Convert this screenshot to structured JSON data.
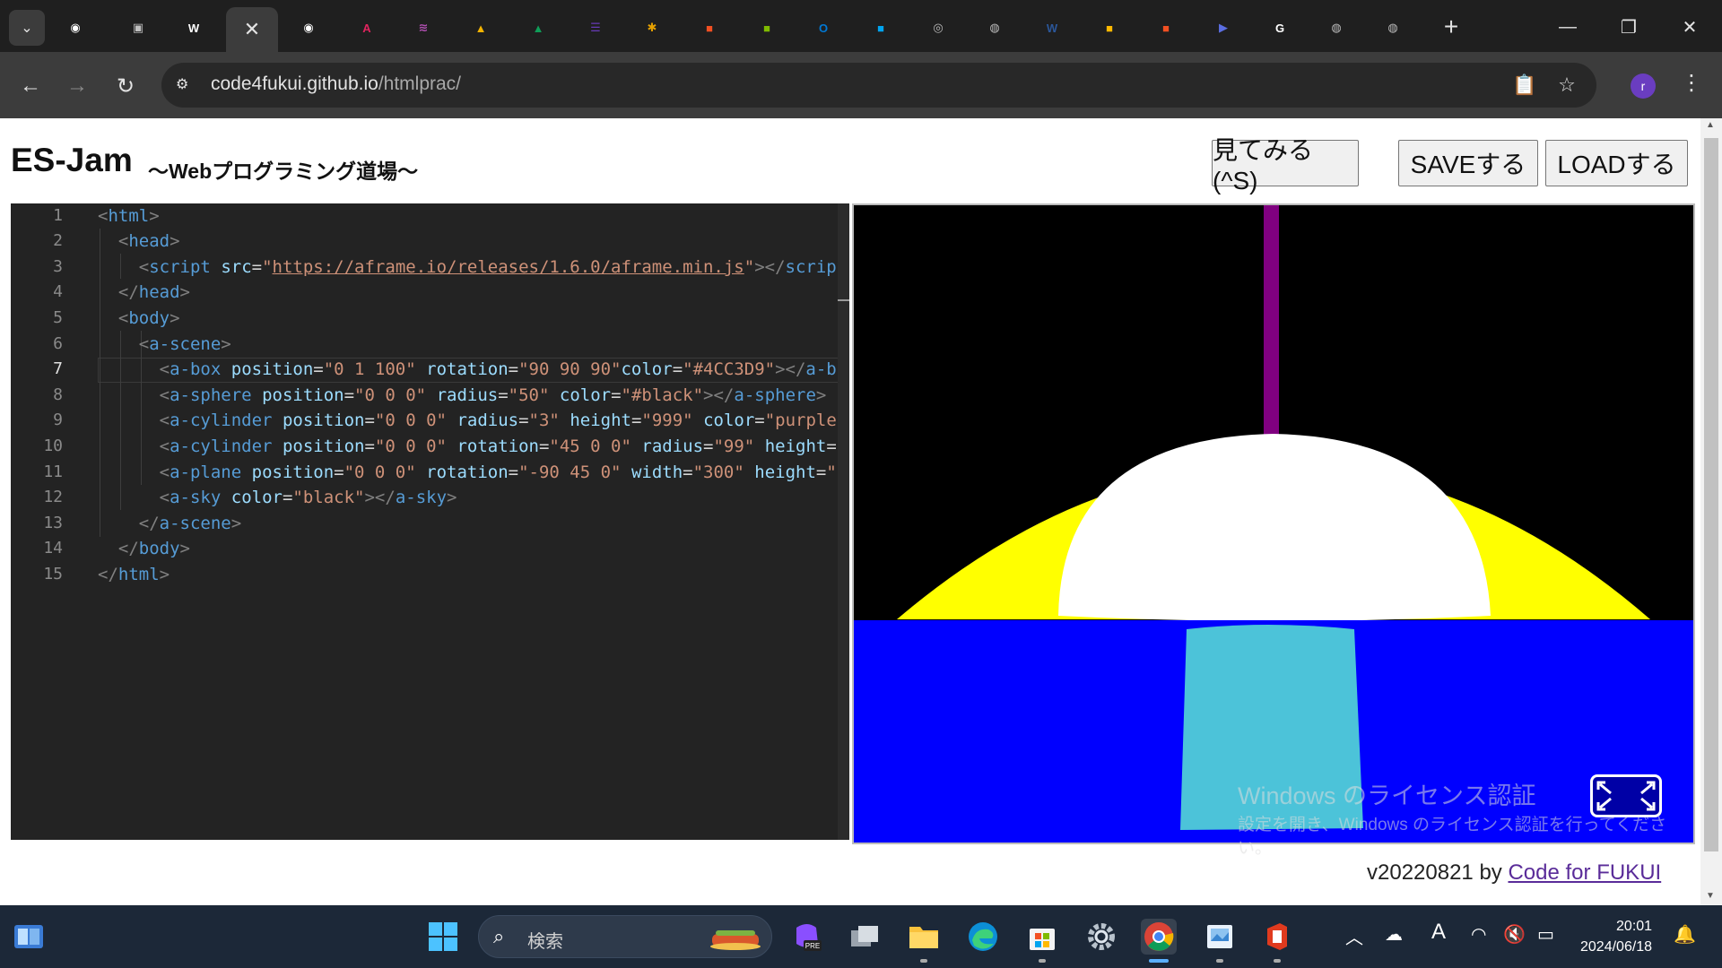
{
  "browser": {
    "url_host": "code4fukui.github.io",
    "url_path": "/htmlprac/",
    "profile_initial": "r",
    "tabs": [
      {
        "icon": "github-icon",
        "color": "#ffffff",
        "glyph": "◉"
      },
      {
        "icon": "contacts-icon",
        "color": "#c0c0c0",
        "glyph": "▣"
      },
      {
        "icon": "wordpress-icon",
        "color": "#ffffff",
        "glyph": "W"
      },
      {
        "icon": "close-icon",
        "active": true
      },
      {
        "icon": "github-icon",
        "color": "#ffffff",
        "glyph": "◉"
      },
      {
        "icon": "app-a-icon",
        "color": "#e0245e",
        "glyph": "A"
      },
      {
        "icon": "stack-icon",
        "color": "#b04fb0",
        "glyph": "≋"
      },
      {
        "icon": "google-drive-icon",
        "color": "#f4b400",
        "glyph": "▲"
      },
      {
        "icon": "google-drive-icon",
        "color": "#0f9d58",
        "glyph": "▲"
      },
      {
        "icon": "forms-icon",
        "color": "#673ab7",
        "glyph": "☰"
      },
      {
        "icon": "palm-icon",
        "color": "#e6a100",
        "glyph": "✱"
      },
      {
        "icon": "microsoft-icon",
        "color": "#f25022",
        "glyph": "■"
      },
      {
        "icon": "microsoft-icon",
        "color": "#7fba00",
        "glyph": "■"
      },
      {
        "icon": "outlook-icon",
        "color": "#0078d4",
        "glyph": "O"
      },
      {
        "icon": "microsoft-icon",
        "color": "#00a4ef",
        "glyph": "■"
      },
      {
        "icon": "chrome-icon",
        "color": "#bbbbbb",
        "glyph": "◎"
      },
      {
        "icon": "globe-icon",
        "color": "#bbbbbb",
        "glyph": "◍"
      },
      {
        "icon": "word-icon",
        "color": "#2b579a",
        "glyph": "W"
      },
      {
        "icon": "microsoft-icon",
        "color": "#ffb900",
        "glyph": "■"
      },
      {
        "icon": "microsoft-icon",
        "color": "#f25022",
        "glyph": "■"
      },
      {
        "icon": "copilot-icon",
        "color": "#5b6ee1",
        "glyph": "▶"
      },
      {
        "icon": "google-icon",
        "color": "#ffffff",
        "glyph": "G"
      },
      {
        "icon": "globe-icon",
        "color": "#bbbbbb",
        "glyph": "◍"
      },
      {
        "icon": "globe-icon",
        "color": "#bbbbbb",
        "glyph": "◍"
      }
    ]
  },
  "page": {
    "title": "ES-Jam",
    "subtitle": "～Webプログラミング道場～",
    "buttons": {
      "view": "見てみる (^S)",
      "save": "SAVEする",
      "load": "LOADする"
    },
    "footer_version": "v20220821 by ",
    "footer_link": "Code for FUKUI"
  },
  "editor": {
    "line_numbers": [
      "1",
      "2",
      "3",
      "4",
      "5",
      "6",
      "7",
      "8",
      "9",
      "10",
      "11",
      "12",
      "13",
      "14",
      "15"
    ],
    "current_line": 7
  },
  "scene": {
    "sky_color": "#000000",
    "ground_color": "#0000ff",
    "dome_color": "#ffffff",
    "ring_color": "#ffff00",
    "pillar_color": "#800080",
    "box_color": "#4CC3D9"
  },
  "watermark": {
    "title": "Windows のライセンス認証",
    "body": "設定を開き、Windows のライセンス認証を行ってください。"
  },
  "taskbar": {
    "search_label": "検索",
    "time": "20:01",
    "date": "2024/06/18"
  }
}
